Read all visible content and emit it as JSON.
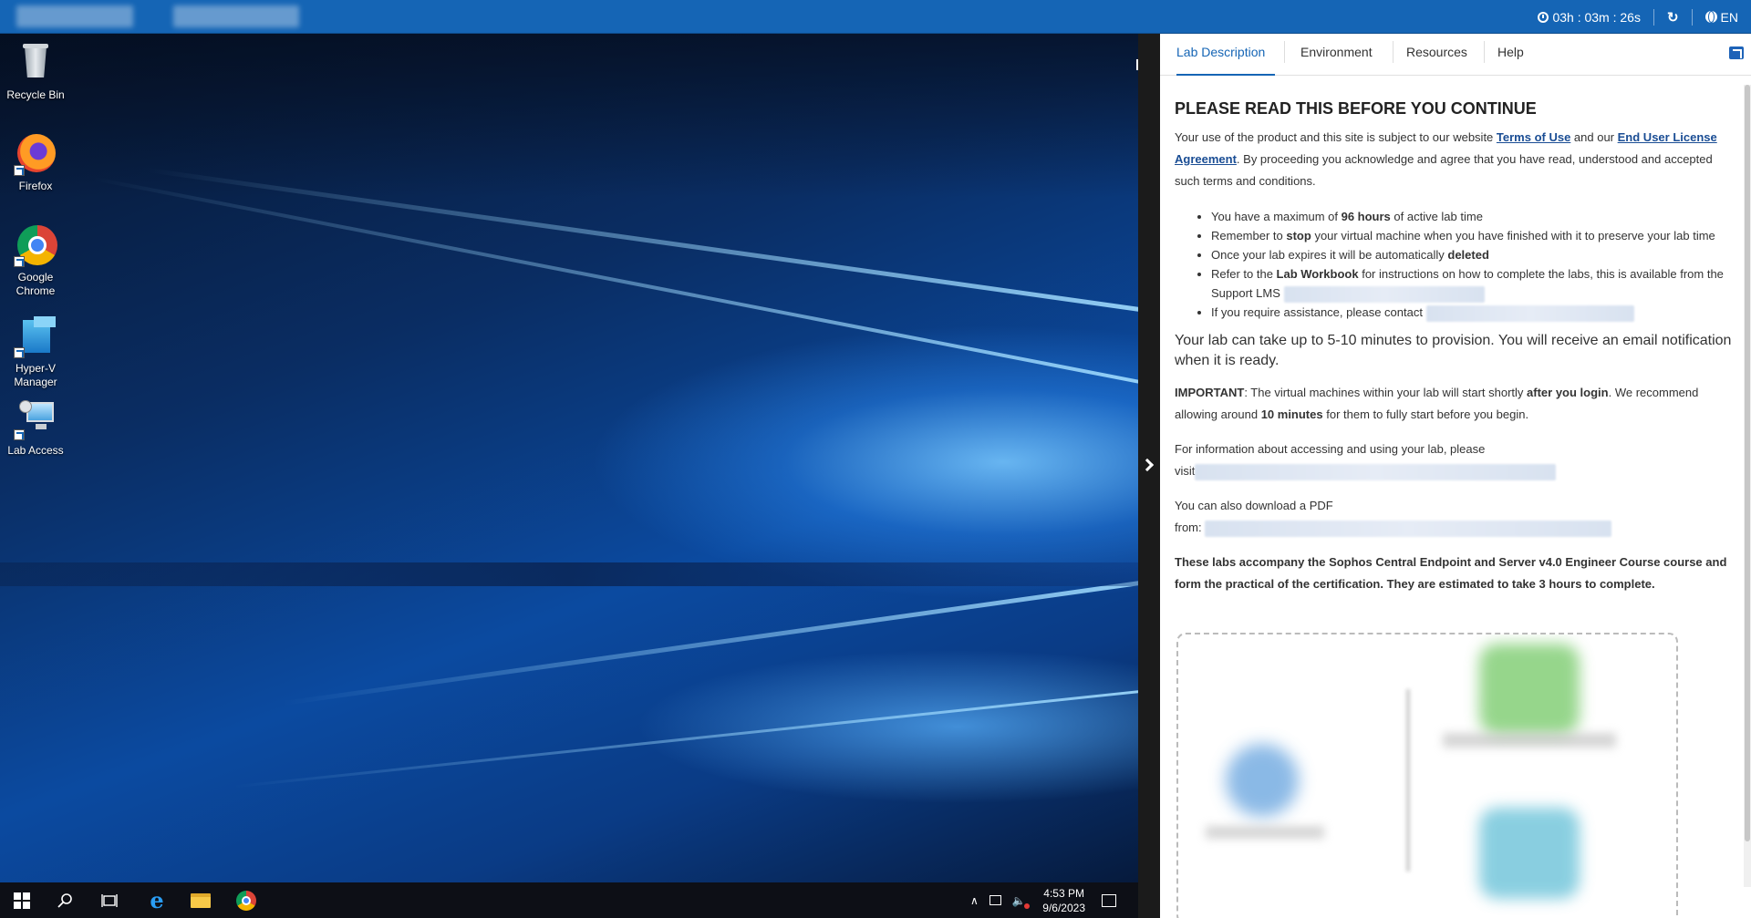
{
  "topbar": {
    "timer": "03h : 03m : 26s",
    "language": "EN"
  },
  "desktop": {
    "icons": [
      {
        "label": "Recycle Bin"
      },
      {
        "label": "Firefox"
      },
      {
        "label": "Google Chrome"
      },
      {
        "label": "Hyper-V Manager"
      },
      {
        "label": "Lab Access"
      }
    ]
  },
  "taskbar": {
    "time": "4:53 PM",
    "date": "9/6/2023"
  },
  "panel": {
    "tabs": [
      "Lab Description",
      "Environment",
      "Resources",
      "Help"
    ],
    "active_tab": "Lab Description",
    "heading": "PLEASE READ THIS BEFORE YOU CONTINUE",
    "intro_1": "Your use of the product and this site is subject to our website ",
    "terms_link": "Terms of Use",
    "intro_2": " and our ",
    "eula_link": "End User License Agreement",
    "intro_3": ". By proceeding you acknowledge and agree that you have read, understood and accepted such terms and conditions.",
    "bullets": {
      "b1_pre": "You have a maximum of ",
      "b1_bold": "96 hours",
      "b1_post": " of active lab time",
      "b2_pre": "Remember to ",
      "b2_bold": "stop",
      "b2_post": " your virtual machine when you have finished with it to preserve your lab time",
      "b3_pre": "Once your lab expires it will be automatically ",
      "b3_bold": "deleted",
      "b4_pre": "Refer to the ",
      "b4_bold": "Lab Workbook",
      "b4_post": " for instructions on how to complete the labs, this is available from the Support LMS",
      "b5_pre": "If you require assistance, please contact"
    },
    "provision": "Your lab can take up to 5-10 minutes to provision. You will receive an email notification when it is ready.",
    "important_label": "IMPORTANT",
    "important_1": ": The virtual machines within your lab will start shortly ",
    "important_bold": "after you login",
    "important_2": ". We recommend allowing around ",
    "important_bold2": "10 minutes",
    "important_3": " for them to fully start before you begin.",
    "info_line1": "For information about accessing and using your lab, please",
    "info_line2": "visit",
    "pdf_line1": "You can also download a PDF",
    "pdf_line2": "from:",
    "course_text": "These labs accompany the Sophos Central Endpoint and Server v4.0 Engineer Course course and form the practical of the certification. They are estimated to take 3 hours to complete."
  }
}
